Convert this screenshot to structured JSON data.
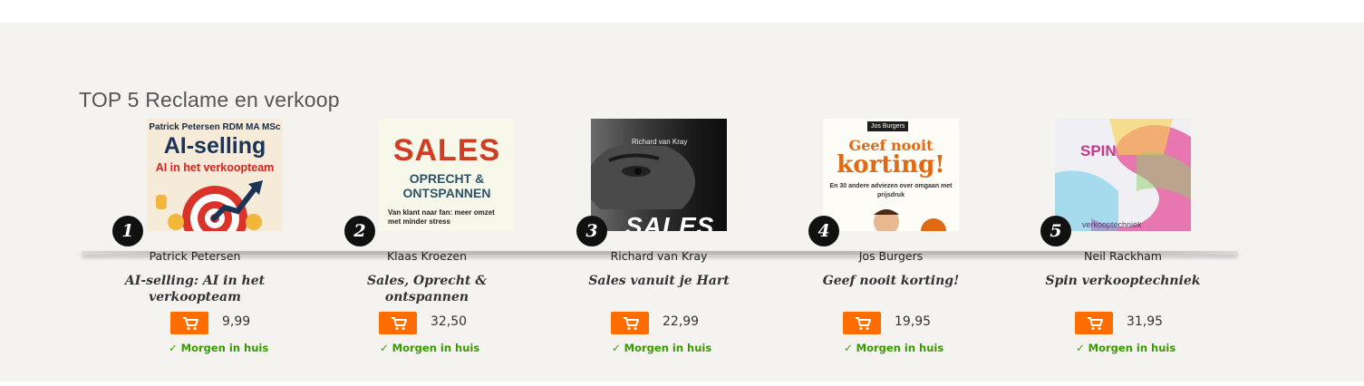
{
  "section": {
    "title": "TOP 5 Reclame en verkoop"
  },
  "delivery_color": "#3b9a00",
  "cart_color": "#ff6d00",
  "items": [
    {
      "rank": "1",
      "author": "Patrick Petersen",
      "title": "AI-selling: AI in het verkoopteam",
      "price": "9,99",
      "delivery": "Morgen in huis",
      "cover": {
        "line1": "Patrick Petersen RDM MA MSc",
        "line2": "AI-selling",
        "line3": "AI in het verkoopteam"
      }
    },
    {
      "rank": "2",
      "author": "Klaas Kroezen",
      "title": "Sales, Oprecht & ontspannen",
      "price": "32,50",
      "delivery": "Morgen in huis",
      "cover": {
        "line1": "SALES",
        "line2": "OPRECHT &",
        "line3": "ONTSPANNEN",
        "line4": "Van klant naar fan: meer omzet met minder stress"
      }
    },
    {
      "rank": "3",
      "author": "Richard van Kray",
      "title": "Sales vanuit je Hart",
      "price": "22,99",
      "delivery": "Morgen in huis",
      "cover": {
        "line1": "Richard van Kray",
        "line2": "SALES"
      }
    },
    {
      "rank": "4",
      "author": "Jos Burgers",
      "title": "Geef nooit korting!",
      "price": "19,95",
      "delivery": "Morgen in huis",
      "cover": {
        "line1": "Jos Burgers",
        "line2": "Geef nooit",
        "line3": "korting!",
        "line4": "En 30 andere adviezen over omgaan met prijsdruk"
      }
    },
    {
      "rank": "5",
      "author": "Neil Rackham",
      "title": "Spin verkooptechniek",
      "price": "31,95",
      "delivery": "Morgen in huis",
      "cover": {
        "line1": "SPIN",
        "line2": "verkooptechniek"
      }
    }
  ]
}
